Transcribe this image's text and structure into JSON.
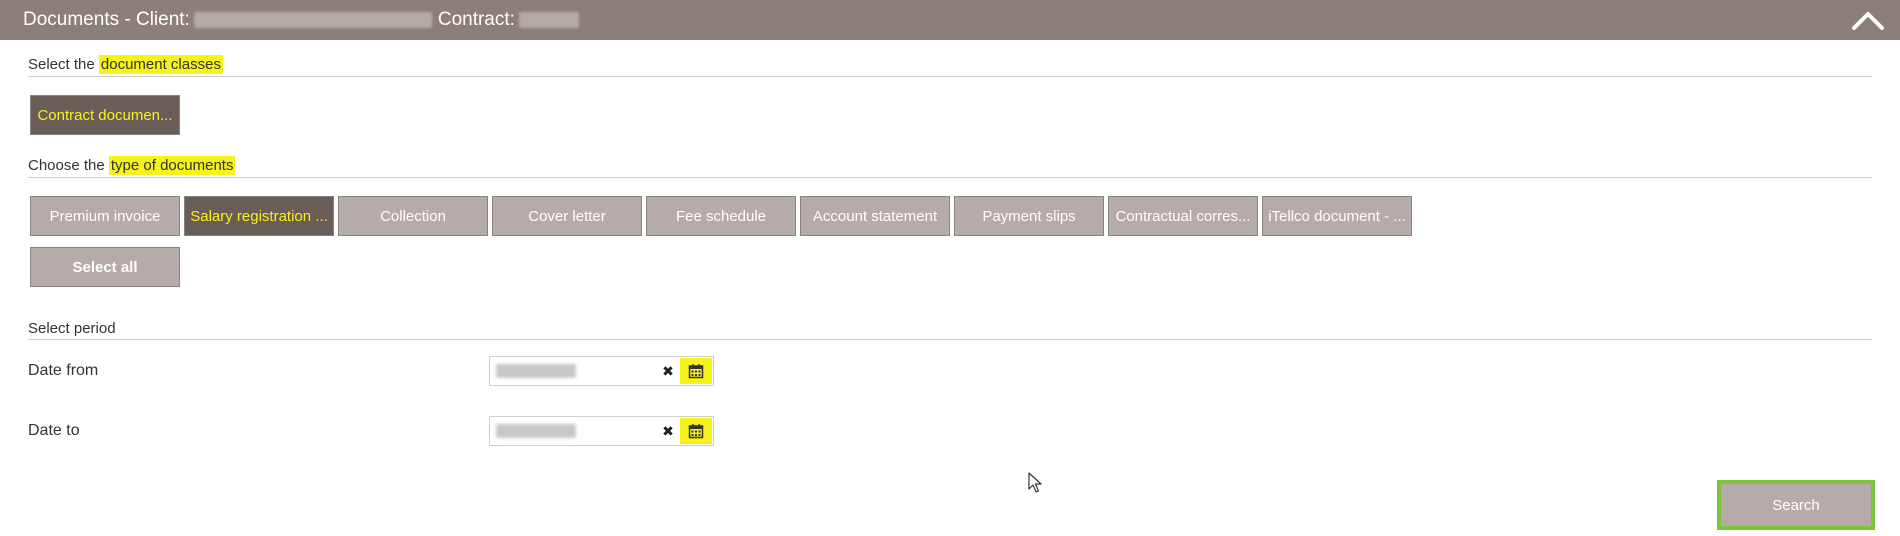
{
  "header": {
    "title_prefix": "Documents - Client:",
    "contract_label": "Contract:"
  },
  "classes_section": {
    "prefix": "Select the ",
    "highlight": "document classes",
    "buttons": [
      {
        "label": "Contract documen...",
        "active": true
      }
    ]
  },
  "types_section": {
    "prefix": "Choose the ",
    "highlight": "type of documents",
    "buttons": [
      {
        "label": "Premium invoice",
        "active": false
      },
      {
        "label": "Salary registration ...",
        "active": true
      },
      {
        "label": "Collection",
        "active": false
      },
      {
        "label": "Cover letter",
        "active": false
      },
      {
        "label": "Fee schedule",
        "active": false
      },
      {
        "label": "Account statement",
        "active": false
      },
      {
        "label": "Payment slips",
        "active": false
      },
      {
        "label": "Contractual corres...",
        "active": false
      },
      {
        "label": "iTellco document - ...",
        "active": false
      }
    ],
    "select_all": "Select all"
  },
  "period_section": {
    "title": "Select period",
    "date_from_label": "Date from",
    "date_to_label": "Date to"
  },
  "search_label": "Search",
  "colors": {
    "header_bg": "#8c7f7a",
    "button_bg": "#b5acaa",
    "button_active_bg": "#6a5c57",
    "highlight": "#f7f21b",
    "focus_border": "#7cc63a"
  },
  "icons": [
    "chevron-up-icon",
    "clear-icon",
    "calendar-icon",
    "mouse-cursor-icon"
  ]
}
